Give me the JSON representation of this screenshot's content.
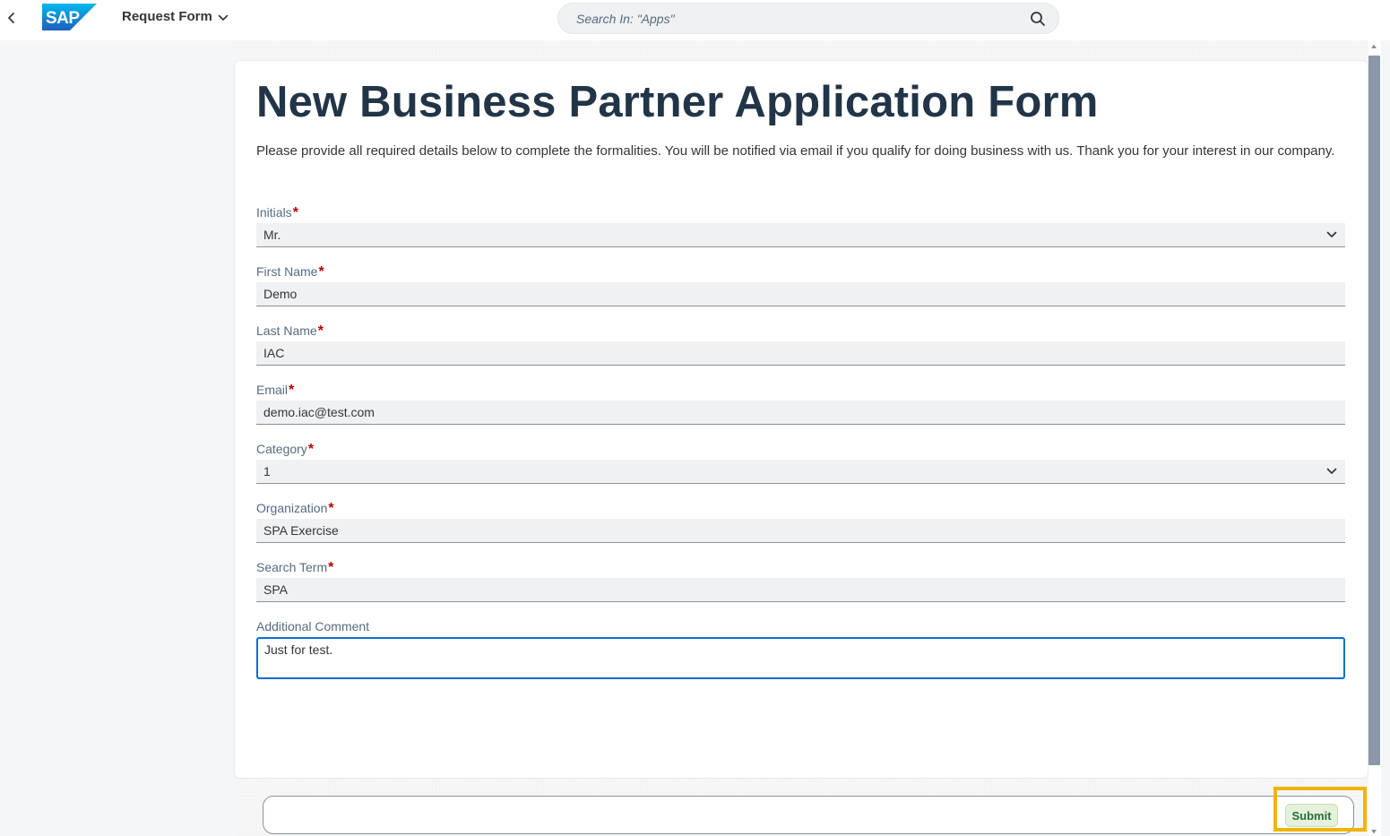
{
  "shell": {
    "app_title": "Request Form",
    "search_placeholder": "Search In: \"Apps\"",
    "logo_text": "SAP"
  },
  "form": {
    "title": "New Business Partner Application Form",
    "description": "Please provide all required details below to complete the formalities. You will be notified via email if you qualify for doing business with us. Thank you for your interest in our company.",
    "required_marker": "*",
    "fields": {
      "initials": {
        "label": "Initials",
        "value": "Mr."
      },
      "first_name": {
        "label": "First Name",
        "value": "Demo"
      },
      "last_name": {
        "label": "Last Name",
        "value": "IAC"
      },
      "email": {
        "label": "Email",
        "value": "demo.iac@test.com"
      },
      "category": {
        "label": "Category",
        "value": "1"
      },
      "organization": {
        "label": "Organization",
        "value": "SPA Exercise"
      },
      "search_term": {
        "label": "Search Term",
        "value": "SPA"
      },
      "additional_comment": {
        "label": "Additional Comment",
        "value": "Just for test."
      }
    }
  },
  "footer": {
    "submit_label": "Submit"
  },
  "colors": {
    "title": "#223548",
    "required": "#bb0000",
    "focus_border": "#0a6ed1",
    "highlight": "#f0b400",
    "submit_bg": "#e6f1dc",
    "submit_text": "#256f3a",
    "logo_blue": "#0070f2"
  },
  "icons": {
    "back": "chevron-left-icon",
    "title_menu": "chevron-down-icon",
    "search": "search-icon",
    "dropdown": "chevron-down-icon",
    "scroll_up": "triangle-up-icon",
    "scroll_down": "triangle-down-icon"
  }
}
